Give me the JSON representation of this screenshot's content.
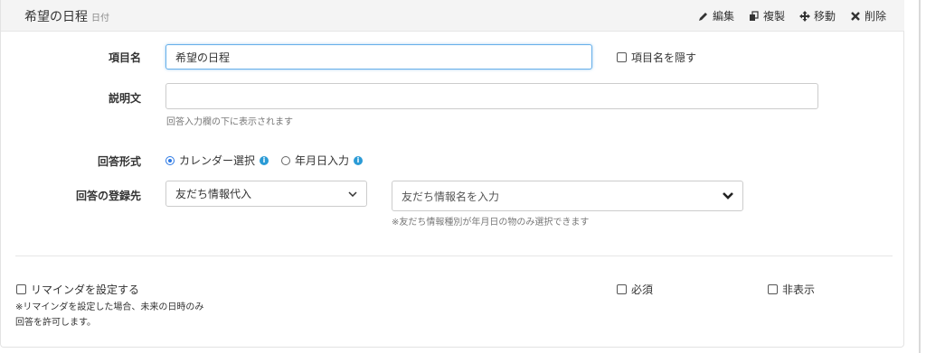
{
  "header": {
    "title": "希望の日程",
    "type_label": "日付",
    "actions": [
      {
        "label": "編集",
        "icon": "pencil-icon"
      },
      {
        "label": "複製",
        "icon": "copy-icon"
      },
      {
        "label": "移動",
        "icon": "move-icon"
      },
      {
        "label": "削除",
        "icon": "delete-icon"
      }
    ]
  },
  "form": {
    "item_name_label": "項目名",
    "item_name_value": "希望の日程",
    "hide_name_label": "項目名を隠す",
    "description_label": "説明文",
    "description_value": "",
    "description_hint": "回答入力欄の下に表示されます",
    "answer_format_label": "回答形式",
    "answer_format_options": [
      "カレンダー選択",
      "年月日入力"
    ],
    "answer_format_selected": "カレンダー選択",
    "destination_label": "回答の登録先",
    "destination_select": "友だち情報代入",
    "destination_field_placeholder": "友だち情報名を入力",
    "destination_hint": "※友だち情報種別が年月日の物のみ選択できます"
  },
  "footer": {
    "reminder_label": "リマインダを設定する",
    "reminder_note_line1": "※リマインダを設定した場合、未来の日時のみ",
    "reminder_note_line2": "回答を許可します。",
    "required_label": "必須",
    "hidden_label": "非表示"
  },
  "colors": {
    "accent": "#2b78e4",
    "info": "#2b9bd6",
    "focus_border": "#66afe9"
  }
}
